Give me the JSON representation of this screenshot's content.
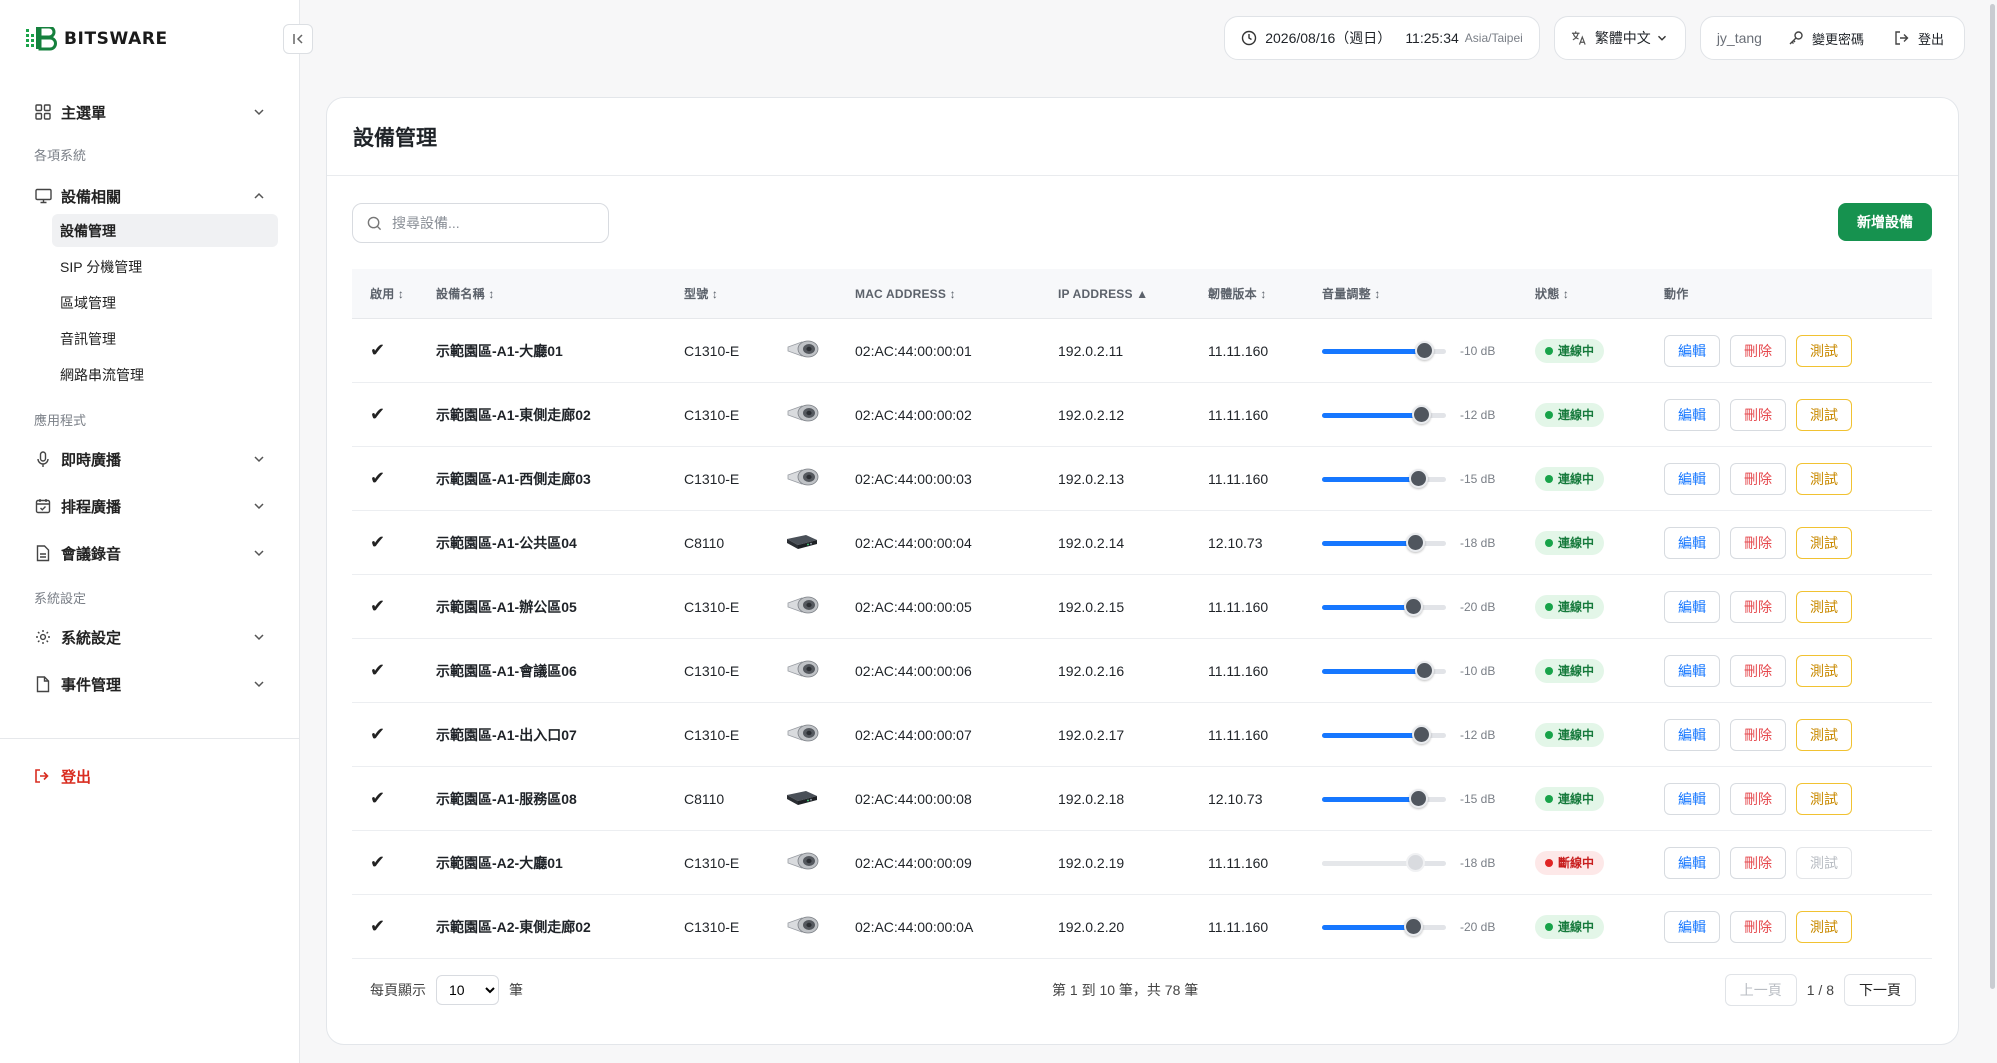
{
  "brand": {
    "name": "BITSWARE"
  },
  "sidebar": {
    "main_menu": "主選單",
    "section_systems": "各項系統",
    "device_group": "設備相關",
    "device_items": [
      "設備管理",
      "SIP 分機管理",
      "區域管理",
      "音訊管理",
      "網路串流管理"
    ],
    "section_apps": "應用程式",
    "apps": [
      "即時廣播",
      "排程廣播",
      "會議錄音"
    ],
    "section_settings": "系統設定",
    "settings": [
      "系統設定",
      "事件管理"
    ],
    "logout": "登出"
  },
  "topbar": {
    "date": "2026/08/16（週日）",
    "time": "11:25:34",
    "timezone": "Asia/Taipei",
    "language": "繁體中文",
    "username": "jy_tang",
    "change_password": "變更密碼",
    "logout": "登出"
  },
  "page": {
    "title": "設備管理",
    "search_placeholder": "搜尋設備...",
    "add_button": "新增設備"
  },
  "table": {
    "headers": [
      "啟用 ↕",
      "設備名稱 ↕",
      "型號 ↕",
      "MAC ADDRESS ↕",
      "IP ADDRESS ▲",
      "韌體版本 ↕",
      "音量調整 ↕",
      "狀態 ↕",
      "動作"
    ],
    "actions": {
      "edit": "編輯",
      "delete": "刪除",
      "test": "測試"
    },
    "rows": [
      {
        "enabled": "✔",
        "name": "示範園區-A1-大廳01",
        "model": "C1310-E",
        "device_icon": "speaker-icon",
        "mac": "02:AC:44:00:00:01",
        "ip": "192.0.2.11",
        "firmware": "11.11.160",
        "volume_db": "-10 dB",
        "volume_level": 0.83,
        "status": "連線中",
        "online": true
      },
      {
        "enabled": "✔",
        "name": "示範園區-A1-東側走廊02",
        "model": "C1310-E",
        "device_icon": "speaker-icon",
        "mac": "02:AC:44:00:00:02",
        "ip": "192.0.2.12",
        "firmware": "11.11.160",
        "volume_db": "-12 dB",
        "volume_level": 0.81,
        "status": "連線中",
        "online": true
      },
      {
        "enabled": "✔",
        "name": "示範園區-A1-西側走廊03",
        "model": "C1310-E",
        "device_icon": "speaker-icon",
        "mac": "02:AC:44:00:00:03",
        "ip": "192.0.2.13",
        "firmware": "11.11.160",
        "volume_db": "-15 dB",
        "volume_level": 0.78,
        "status": "連線中",
        "online": true
      },
      {
        "enabled": "✔",
        "name": "示範園區-A1-公共區04",
        "model": "C8110",
        "device_icon": "amplifier-icon",
        "mac": "02:AC:44:00:00:04",
        "ip": "192.0.2.14",
        "firmware": "12.10.73",
        "volume_db": "-18 dB",
        "volume_level": 0.76,
        "status": "連線中",
        "online": true
      },
      {
        "enabled": "✔",
        "name": "示範園區-A1-辦公區05",
        "model": "C1310-E",
        "device_icon": "speaker-icon",
        "mac": "02:AC:44:00:00:05",
        "ip": "192.0.2.15",
        "firmware": "11.11.160",
        "volume_db": "-20 dB",
        "volume_level": 0.74,
        "status": "連線中",
        "online": true
      },
      {
        "enabled": "✔",
        "name": "示範園區-A1-會議區06",
        "model": "C1310-E",
        "device_icon": "speaker-icon",
        "mac": "02:AC:44:00:00:06",
        "ip": "192.0.2.16",
        "firmware": "11.11.160",
        "volume_db": "-10 dB",
        "volume_level": 0.83,
        "status": "連線中",
        "online": true
      },
      {
        "enabled": "✔",
        "name": "示範園區-A1-出入口07",
        "model": "C1310-E",
        "device_icon": "speaker-icon",
        "mac": "02:AC:44:00:00:07",
        "ip": "192.0.2.17",
        "firmware": "11.11.160",
        "volume_db": "-12 dB",
        "volume_level": 0.81,
        "status": "連線中",
        "online": true
      },
      {
        "enabled": "✔",
        "name": "示範園區-A1-服務區08",
        "model": "C8110",
        "device_icon": "amplifier-icon",
        "mac": "02:AC:44:00:00:08",
        "ip": "192.0.2.18",
        "firmware": "12.10.73",
        "volume_db": "-15 dB",
        "volume_level": 0.78,
        "status": "連線中",
        "online": true
      },
      {
        "enabled": "✔",
        "name": "示範園區-A2-大廳01",
        "model": "C1310-E",
        "device_icon": "speaker-icon",
        "mac": "02:AC:44:00:00:09",
        "ip": "192.0.2.19",
        "firmware": "11.11.160",
        "volume_db": "-18 dB",
        "volume_level": 0.76,
        "status": "斷線中",
        "online": false
      },
      {
        "enabled": "✔",
        "name": "示範園區-A2-東側走廊02",
        "model": "C1310-E",
        "device_icon": "speaker-icon",
        "mac": "02:AC:44:00:00:0A",
        "ip": "192.0.2.20",
        "firmware": "11.11.160",
        "volume_db": "-20 dB",
        "volume_level": 0.74,
        "status": "連線中",
        "online": true
      }
    ]
  },
  "pagination": {
    "per_page_label": "每頁顯示",
    "per_page_value": "10",
    "per_page_unit": "筆",
    "summary": "第 1 到 10 筆，共 78 筆",
    "prev": "上一頁",
    "page_info": "1 / 8",
    "next": "下一頁"
  },
  "colors": {
    "primary": "#16924f",
    "slider": "#1677ff",
    "online": "#18a34a",
    "offline": "#e02424",
    "logout": "#d92d20"
  }
}
